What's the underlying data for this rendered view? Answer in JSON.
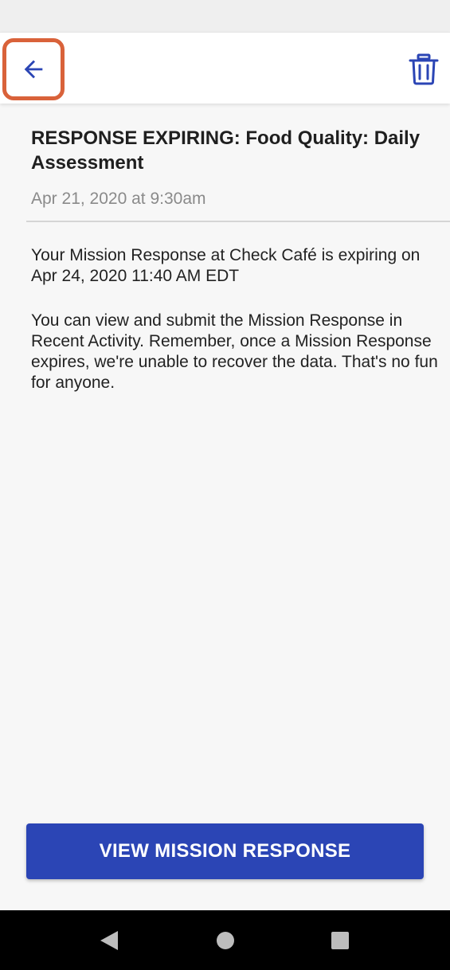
{
  "colors": {
    "accent": "#2b45b5",
    "highlight": "#d9623a",
    "background": "#f7f7f7"
  },
  "toolbar": {
    "back_icon": "arrow-left-icon",
    "delete_icon": "trash-icon"
  },
  "notification": {
    "title": "RESPONSE EXPIRING: Food Quality: Daily Assessment",
    "date": "Apr 21, 2020 at 9:30am",
    "paragraph_1": "Your Mission Response at Check Café is expiring on Apr 24, 2020 11:40 AM EDT",
    "paragraph_2": "You can view and submit the Mission Response in Recent Activity. Remember, once a Mission Response expires, we're unable to recover the data. That's no fun for anyone."
  },
  "actions": {
    "view_label": "VIEW MISSION RESPONSE"
  },
  "system_nav": {
    "back_icon": "triangle-back-icon",
    "home_icon": "circle-home-icon",
    "recents_icon": "square-recents-icon"
  }
}
